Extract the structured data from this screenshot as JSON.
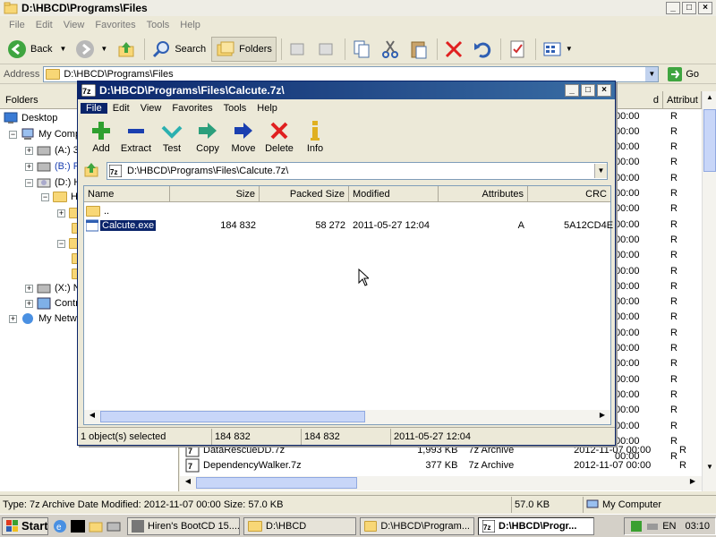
{
  "explorer": {
    "title": "D:\\HBCD\\Programs\\Files",
    "menu": [
      "File",
      "Edit",
      "View",
      "Favorites",
      "Tools",
      "Help"
    ],
    "toolbar": {
      "back": "Back",
      "search": "Search",
      "folders": "Folders"
    },
    "address_label": "Address",
    "address_value": "D:\\HBCD\\Programs\\Files",
    "go": "Go",
    "folders_header": "Folders",
    "tree": [
      {
        "label": "Desktop"
      },
      {
        "label": "My Comp"
      },
      {
        "label": "(A:) 3"
      },
      {
        "label": "(B:) F"
      },
      {
        "label": "(D:) H"
      },
      {
        "label": "H"
      },
      {
        "label": ""
      },
      {
        "label": ""
      },
      {
        "label": ""
      },
      {
        "label": ""
      },
      {
        "label": ""
      },
      {
        "label": "(X:) N"
      },
      {
        "label": "Contr"
      },
      {
        "label": "My Netw"
      }
    ],
    "list_header": {
      "modified_partial": "d",
      "attributes": "Attribut"
    },
    "list_right_rows": [
      "00:00",
      "00:00",
      "00:00",
      "00:00",
      "00:00",
      "00:00",
      "00:00",
      "00:00",
      "00:00",
      "00:00",
      "00:00",
      "00:00",
      "00:00",
      "00:00",
      "00:00",
      "00:00",
      "00:00",
      "00:00",
      "00:00",
      "00:00",
      "00:00",
      "00:00",
      "00:00"
    ],
    "attr_value": "R",
    "bottom_rows": [
      {
        "name": "DataRescueDD.7z",
        "size": "1,993 KB",
        "type": "7z Archive",
        "modified": "2012-11-07 00:00",
        "attr": "R"
      },
      {
        "name": "DependencyWalker.7z",
        "size": "377 KB",
        "type": "7z Archive",
        "modified": "2012-11-07 00:00",
        "attr": "R"
      }
    ],
    "status": {
      "info": "Type: 7z Archive Date Modified: 2012-11-07 00:00 Size: 57.0 KB",
      "size": "57.0 KB",
      "zone": "My Computer"
    }
  },
  "zip": {
    "title": "D:\\HBCD\\Programs\\Files\\Calcute.7z\\",
    "menu": [
      "File",
      "Edit",
      "View",
      "Favorites",
      "Tools",
      "Help"
    ],
    "buttons": [
      "Add",
      "Extract",
      "Test",
      "Copy",
      "Move",
      "Delete",
      "Info"
    ],
    "path": "D:\\HBCD\\Programs\\Files\\Calcute.7z\\",
    "columns": [
      "Name",
      "Size",
      "Packed Size",
      "Modified",
      "Attributes",
      "CRC"
    ],
    "parent": "..",
    "rows": [
      {
        "name": "Calcute.exe",
        "size": "184 832",
        "packed": "58 272",
        "modified": "2011-05-27 12:04",
        "attributes": "A",
        "crc": "5A12CD4E"
      }
    ],
    "status": [
      "1 object(s) selected",
      "184 832",
      "184 832",
      "2011-05-27 12:04"
    ]
  },
  "taskbar": {
    "start": "Start",
    "tasks": [
      "Hiren's BootCD 15....",
      "D:\\HBCD",
      "D:\\HBCD\\Program...",
      "D:\\HBCD\\Progr..."
    ],
    "lang": "EN",
    "time": "03:10"
  }
}
